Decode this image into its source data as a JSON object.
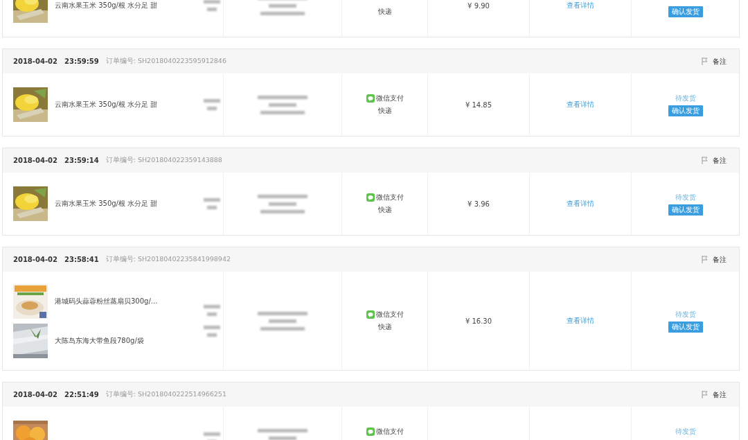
{
  "orders": [
    {
      "items": [
        {
          "name": "云南水果玉米 350g/根 水分足 甜",
          "kind": "picture"
        }
      ],
      "payment": {
        "shipping": "快递"
      },
      "total": "¥ 9.90",
      "detail_link": "查看详情",
      "status": {
        "button": "确认发货"
      }
    },
    {
      "header": {
        "date": "2018-04-02",
        "time": "23:59:59",
        "order_no": "订单编号: SH2018040223595912846",
        "note": "备注"
      },
      "items": [
        {
          "name": "云南水果玉米 350g/根 水分足 甜",
          "kind": "picture"
        }
      ],
      "payment": {
        "method": "微信支付",
        "shipping": "快递"
      },
      "total": "¥ 14.85",
      "detail_link": "查看详情",
      "status": {
        "text": "待发货",
        "button": "确认发货"
      }
    },
    {
      "header": {
        "date": "2018-04-02",
        "time": "23:59:14",
        "order_no": "订单编号: SH201804022359143888",
        "note": "备注"
      },
      "items": [
        {
          "name": "云南水果玉米 350g/根 水分足 甜",
          "kind": "picture"
        }
      ],
      "payment": {
        "method": "微信支付",
        "shipping": "快递"
      },
      "total": "¥ 3.96",
      "detail_link": "查看详情",
      "status": {
        "text": "待发货",
        "button": "确认发货"
      }
    },
    {
      "header": {
        "date": "2018-04-02",
        "time": "23:58:41",
        "order_no": "订单编号: SH20180402235841998942",
        "note": "备注"
      },
      "items": [
        {
          "name": "港城码头蒜蓉粉丝蒸扇贝300g/...",
          "kind": "picture"
        },
        {
          "name": "大陈岛东海大带鱼段780g/袋",
          "kind": "picture"
        }
      ],
      "payment": {
        "method": "微信支付",
        "shipping": "快递"
      },
      "total": "¥ 16.30",
      "detail_link": "查看详情",
      "status": {
        "text": "待发货",
        "button": "确认发货"
      }
    },
    {
      "header": {
        "date": "2018-04-02",
        "time": "22:51:49",
        "order_no": "订单编号: SH2018040222514966251",
        "note": "备注"
      },
      "payment": {
        "method": "微信支付"
      },
      "status": {
        "text": "待发货"
      }
    }
  ]
}
